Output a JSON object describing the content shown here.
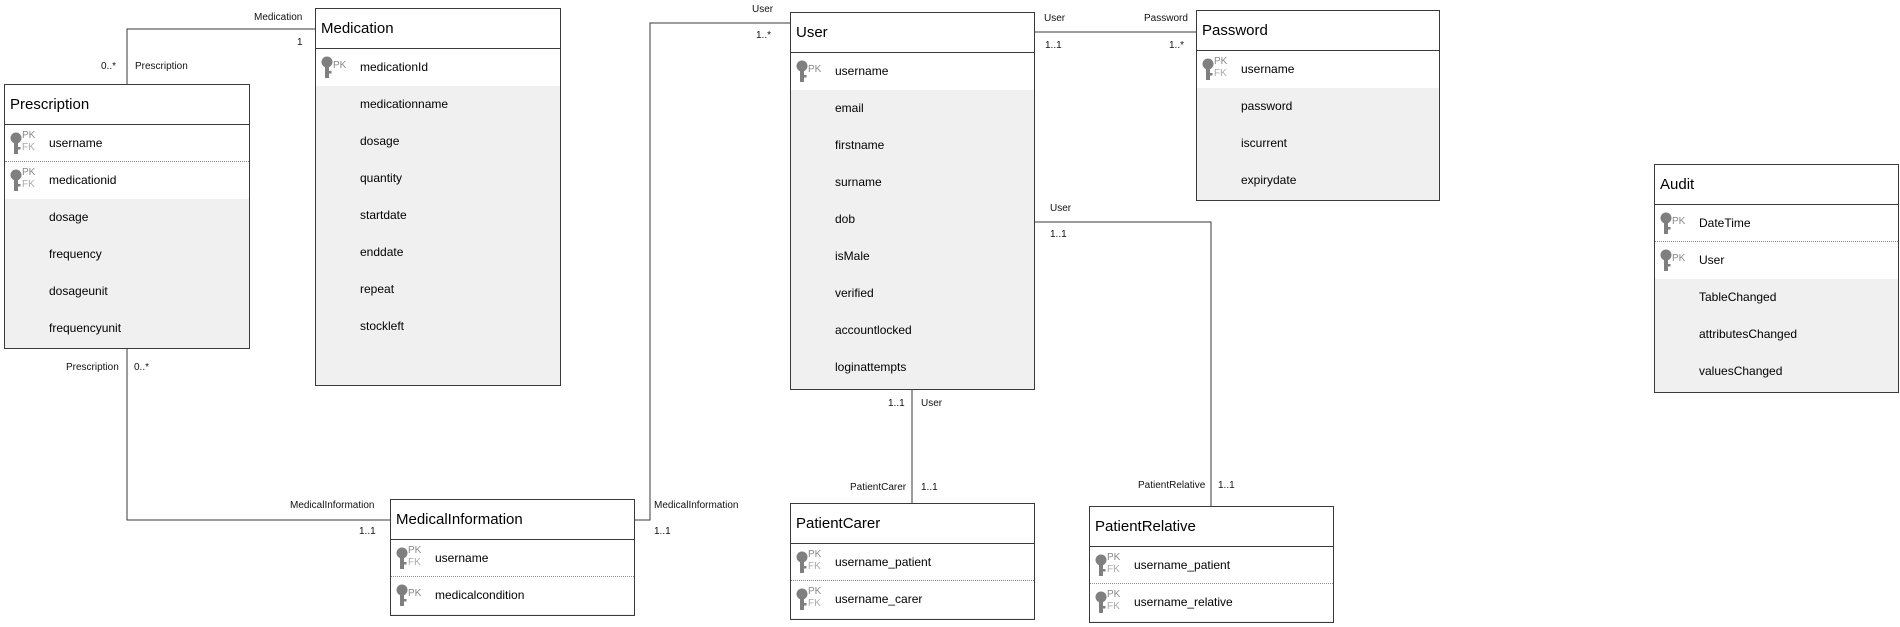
{
  "diagram": {
    "entities": {
      "medication": {
        "title": "Medication",
        "keys": [
          {
            "name": "medicationId",
            "tags": [
              "PK"
            ]
          }
        ],
        "attributes": [
          "medicationname",
          "dosage",
          "quantity",
          "startdate",
          "enddate",
          "repeat",
          "stockleft"
        ]
      },
      "prescription": {
        "title": "Prescription",
        "keys": [
          {
            "name": "username",
            "tags": [
              "PK",
              "FK"
            ]
          },
          {
            "name": "medicationid",
            "tags": [
              "PK",
              "FK"
            ]
          }
        ],
        "attributes": [
          "dosage",
          "frequency",
          "dosageunit",
          "frequencyunit"
        ]
      },
      "user": {
        "title": "User",
        "keys": [
          {
            "name": "username",
            "tags": [
              "PK"
            ]
          }
        ],
        "attributes": [
          "email",
          "firstname",
          "surname",
          "dob",
          "isMale",
          "verified",
          "accountlocked",
          "loginattempts"
        ]
      },
      "password": {
        "title": "Password",
        "keys": [
          {
            "name": "username",
            "tags": [
              "PK",
              "FK"
            ]
          }
        ],
        "attributes": [
          "password",
          "iscurrent",
          "expirydate"
        ]
      },
      "audit": {
        "title": "Audit",
        "keys": [
          {
            "name": "DateTime",
            "tags": [
              "PK"
            ]
          },
          {
            "name": "User",
            "tags": [
              "PK"
            ]
          }
        ],
        "attributes": [
          "TableChanged",
          "attributesChanged",
          "valuesChanged"
        ]
      },
      "medicalinformation": {
        "title": "MedicalInformation",
        "keys": [
          {
            "name": "username",
            "tags": [
              "PK",
              "FK"
            ]
          },
          {
            "name": "medicalcondition",
            "tags": [
              "PK"
            ]
          }
        ],
        "attributes": []
      },
      "patientcarer": {
        "title": "PatientCarer",
        "keys": [
          {
            "name": "username_patient",
            "tags": [
              "PK",
              "FK"
            ]
          },
          {
            "name": "username_carer",
            "tags": [
              "PK",
              "FK"
            ]
          }
        ],
        "attributes": []
      },
      "patientrelative": {
        "title": "PatientRelative",
        "keys": [
          {
            "name": "username_patient",
            "tags": [
              "PK",
              "FK"
            ]
          },
          {
            "name": "username_relative",
            "tags": [
              "PK",
              "FK"
            ]
          }
        ],
        "attributes": []
      }
    },
    "relationships": [
      {
        "id": "med-pres",
        "end_a": {
          "role": "Medication",
          "multiplicity": "1"
        },
        "end_b": {
          "role": "Prescription",
          "multiplicity": "0..*"
        }
      },
      {
        "id": "pres-medinfo",
        "end_a": {
          "role": "Prescription",
          "multiplicity": "0..*"
        },
        "end_b": {
          "role": "MedicalInformation",
          "multiplicity": "1..1"
        }
      },
      {
        "id": "medinfo-user",
        "end_a": {
          "role": "MedicalInformation",
          "multiplicity": "1..1"
        },
        "end_b": {
          "role": "User",
          "multiplicity": "1..*"
        }
      },
      {
        "id": "user-password",
        "end_a": {
          "role": "User",
          "multiplicity": "1..1"
        },
        "end_b": {
          "role": "Password",
          "multiplicity": "1..*"
        }
      },
      {
        "id": "user-carer",
        "end_a": {
          "role": "User",
          "multiplicity": "1..1"
        },
        "end_b": {
          "role": "PatientCarer",
          "multiplicity": "1..1"
        }
      },
      {
        "id": "user-relative",
        "end_a": {
          "role": "User",
          "multiplicity": "1..1"
        },
        "end_b": {
          "role": "PatientRelative",
          "multiplicity": "1..1"
        }
      }
    ],
    "colors": {
      "line": "#3a3a3a",
      "attribute_bg": "#f0f0f0",
      "key_bg": "#ffffff",
      "key_icon": "#7f7f7f",
      "fk_text": "#aaaaaa"
    }
  }
}
